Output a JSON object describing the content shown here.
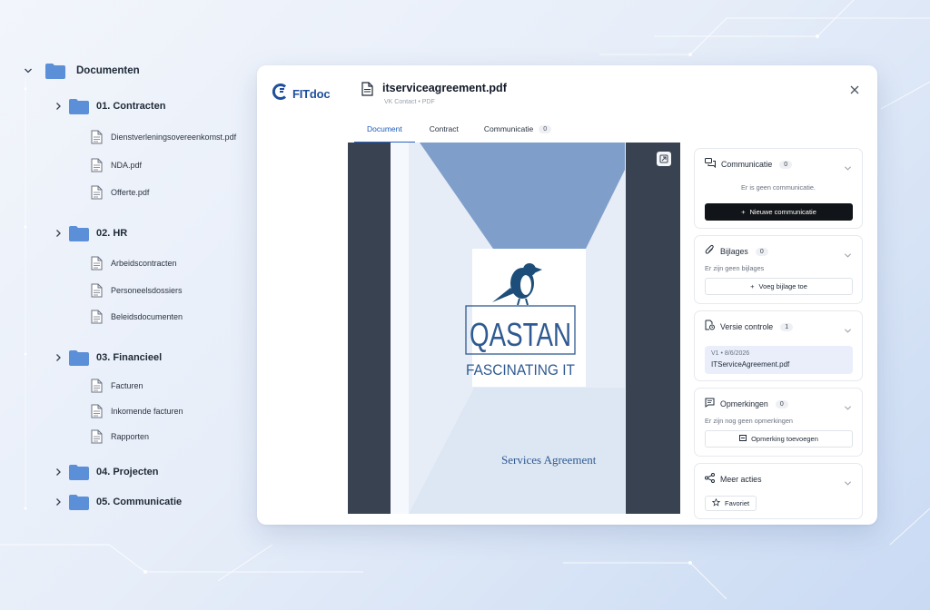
{
  "tree": {
    "root": {
      "label": "Documenten"
    },
    "folders": [
      {
        "label": "01. Contracten",
        "files": [
          "Dienstverleningsovereenkomst.pdf",
          "NDA.pdf",
          "Offerte.pdf"
        ]
      },
      {
        "label": "02. HR",
        "files": [
          "Arbeidscontracten",
          "Personeelsdossiers",
          "Beleidsdocumenten"
        ]
      },
      {
        "label": "03. Financieel",
        "files": [
          "Facturen",
          "Inkomende facturen",
          "Rapporten"
        ]
      },
      {
        "label": "04. Projecten",
        "files": []
      },
      {
        "label": "05. Communicatie",
        "files": []
      }
    ]
  },
  "app": {
    "logo_text": "FITdoc",
    "file_title": "itserviceagreement.pdf",
    "file_sub": "VK Contact • PDF",
    "tabs": [
      {
        "label": "Document",
        "active": true
      },
      {
        "label": "Contract",
        "active": false
      },
      {
        "label": "Communicatie",
        "badge": "0",
        "active": false
      }
    ]
  },
  "document": {
    "brand": "QASTAN",
    "tagline": "FASCINATING IT",
    "title": "Services Agreement"
  },
  "panel": {
    "communicatie": {
      "title": "Communicatie",
      "count": "0",
      "empty": "Er is geen communicatie.",
      "button": "Nieuwe communicatie"
    },
    "bijlages": {
      "title": "Bijlages",
      "count": "0",
      "empty": "Er zijn geen bijlages",
      "button": "Voeg bijlage toe"
    },
    "versie": {
      "title": "Versie controle",
      "count": "1",
      "meta": "V1 • 8/6/2026",
      "file": "ITServiceAgreement.pdf"
    },
    "opmerkingen": {
      "title": "Opmerkingen",
      "count": "0",
      "empty": "Er zijn nog geen opmerkingen",
      "button": "Opmerking toevoegen"
    },
    "acties": {
      "title": "Meer acties",
      "favorite": "Favoriet"
    }
  },
  "colors": {
    "accent": "#2a63c2",
    "folder": "#5b8fd8",
    "viewer_bg": "#394251",
    "doc_blue": "#7f9fca"
  }
}
